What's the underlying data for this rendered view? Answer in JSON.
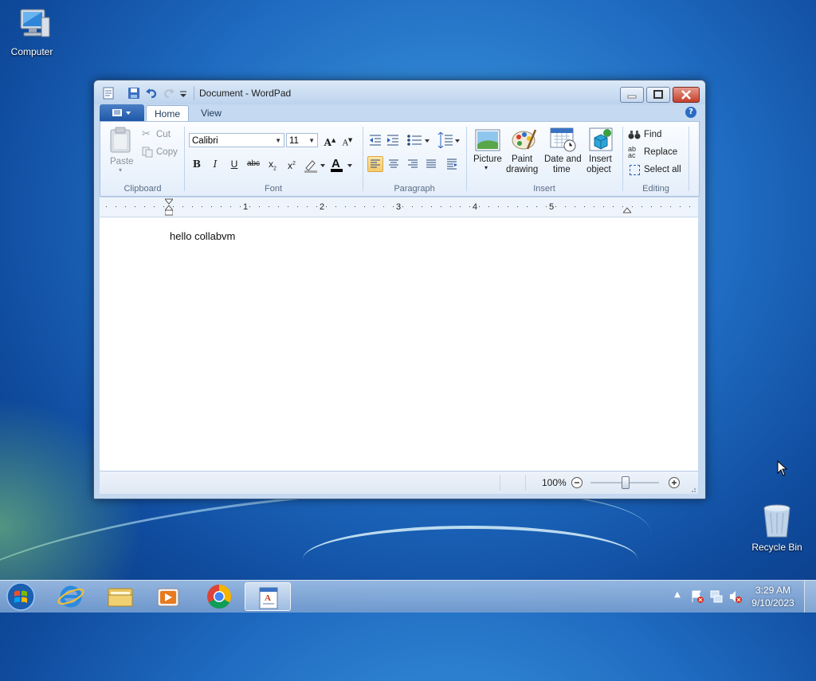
{
  "desktop": {
    "icons": [
      {
        "label": "Computer"
      },
      {
        "label": "Recycle Bin"
      }
    ]
  },
  "window": {
    "title": "Document - WordPad",
    "tabs": [
      {
        "label": "Home"
      },
      {
        "label": "View"
      }
    ],
    "ribbon": {
      "clipboard": {
        "group": "Clipboard",
        "paste": "Paste",
        "cut": "Cut",
        "copy": "Copy"
      },
      "font": {
        "group": "Font",
        "family": "Calibri",
        "size": "11"
      },
      "paragraph": {
        "group": "Paragraph"
      },
      "insert": {
        "group": "Insert",
        "picture": "Picture",
        "paint_line1": "Paint",
        "paint_line2": "drawing",
        "datetime_line1": "Date and",
        "datetime_line2": "time",
        "object_line1": "Insert",
        "object_line2": "object"
      },
      "editing": {
        "group": "Editing",
        "find": "Find",
        "replace": "Replace",
        "select_all": "Select all"
      }
    },
    "ruler": {
      "numbers": [
        "1",
        "2",
        "3",
        "4",
        "5"
      ]
    },
    "document": {
      "text": "hello collabvm"
    },
    "status": {
      "zoom": "100%"
    }
  },
  "taskbar": {
    "clock_time": "3:29 AM",
    "clock_date": "9/10/2023"
  }
}
